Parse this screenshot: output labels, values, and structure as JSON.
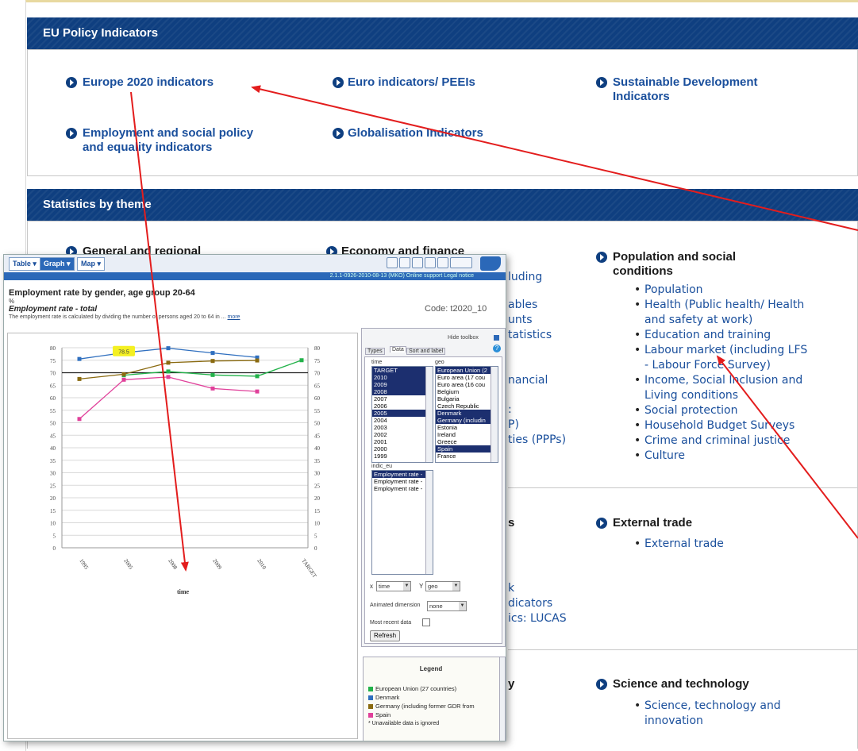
{
  "policy": {
    "header": "EU Policy Indicators",
    "links": [
      {
        "label": "Europe 2020 indicators"
      },
      {
        "label": "Euro indicators/ PEEIs"
      },
      {
        "label": "Sustainable Development\nIndicators"
      },
      {
        "label": "Employment and social policy\nand equality indicators"
      },
      {
        "label": "Globalisation Indicators"
      }
    ]
  },
  "themes": {
    "header": "Statistics by theme",
    "general": "General and regional",
    "economy": "Economy and finance",
    "population": {
      "title": "Population and social\nconditions",
      "items": [
        "Population",
        "Health (Public health/ Health\nand safety at work)",
        "Education and training",
        "Labour market (including LFS\n- Labour Force Survey)",
        "Income, Social Inclusion and\nLiving conditions",
        "Social protection",
        "Household Budget Surveys",
        "Crime and criminal justice",
        "Culture"
      ]
    },
    "external_trade": {
      "title": "External trade",
      "items": [
        "External trade"
      ]
    },
    "science": {
      "title": "Science and technology",
      "items": [
        "Science, technology and\ninnovation"
      ]
    },
    "fragments": [
      "luding",
      "ables",
      "unts",
      "tatistics",
      "nancial",
      ":",
      "P)",
      "ties (PPPs)",
      "s",
      "k",
      "dicators",
      "ics: LUCAS",
      "y"
    ]
  },
  "overlay": {
    "tabs": [
      "Table ▾",
      "Graph ▾",
      "Map ▾"
    ],
    "strip_text": "2.1.1-0926-2010-08-13 (MKO)   Online support   Legal notice",
    "title": "Employment rate by gender, age group 20-64",
    "unit": "%",
    "subtitle": "Employment rate - total",
    "description": "The employment rate is calculated by dividing the number of persons aged 20 to 64 in ...",
    "more": "more",
    "code": "Code: t2020_10",
    "hide_toolbox": "Hide toolbox",
    "panel_tabs": [
      "Types",
      "Data",
      "Sort and label"
    ],
    "time_label": "time",
    "geo_label": "geo",
    "time_options": [
      "TARGET",
      "2010",
      "2009",
      "2008",
      "2007",
      "2006",
      "2005",
      "2004",
      "2003",
      "2002",
      "2001",
      "2000",
      "1999"
    ],
    "time_selected": [
      "TARGET",
      "2010",
      "2009",
      "2008",
      "2005"
    ],
    "geo_options": [
      "European Union (2",
      "Euro area (17 cou",
      "Euro area (16 cou",
      "Belgium",
      "Bulgaria",
      "Czech Republic",
      "Denmark",
      "Germany (includin",
      "Estonia",
      "Ireland",
      "Greece",
      "Spain",
      "France"
    ],
    "geo_selected": [
      "European Union (2",
      "Denmark",
      "Germany (includin",
      "Spain"
    ],
    "indic_label": "indic_eu",
    "indic_options": [
      "Employment rate -",
      "Employment rate -",
      "Employment rate -"
    ],
    "x_label": "x",
    "x_value": "time",
    "y_label": "Y",
    "y_value": "geo",
    "animated_label": "Animated dimension",
    "animated_value": "none",
    "most_recent_label": "Most recent data",
    "refresh": "Refresh",
    "legend_title": "Legend",
    "legend": [
      {
        "name": "European Union (27 countries)",
        "color": "#22b24a"
      },
      {
        "name": "Denmark",
        "color": "#2f6fbf"
      },
      {
        "name": "Germany (including  former GDR from",
        "color": "#8a6a10"
      },
      {
        "name": "Spain",
        "color": "#e0409a"
      }
    ],
    "legend_note": "* Unavailable data is ignored",
    "x_axis_title": "time"
  },
  "chart_data": {
    "type": "line",
    "title": "Employment rate by gender, age group 20-64",
    "xlabel": "time",
    "ylabel": "",
    "ylim": [
      0,
      80
    ],
    "yticks": [
      0,
      5,
      10,
      15,
      20,
      25,
      30,
      35,
      40,
      45,
      50,
      55,
      60,
      65,
      70,
      75,
      80
    ],
    "categories": [
      "1995",
      "2005",
      "2008",
      "2009",
      "2010",
      "TARGET"
    ],
    "target_line": 70,
    "highlight_label": "78.5",
    "series": [
      {
        "name": "European Union (27 countries)",
        "color": "#22b24a",
        "values": [
          null,
          69,
          70.5,
          69.1,
          68.6,
          75
        ]
      },
      {
        "name": "Denmark",
        "color": "#2f6fbf",
        "values": [
          75.5,
          78,
          79.8,
          77.9,
          76.1,
          null
        ]
      },
      {
        "name": "Germany (including  former GDR from",
        "color": "#8a6a10",
        "values": [
          67.5,
          69.4,
          74,
          74.7,
          74.9,
          null
        ]
      },
      {
        "name": "Spain",
        "color": "#e0409a",
        "values": [
          51.5,
          67.2,
          68.3,
          63.7,
          62.5,
          null
        ]
      }
    ]
  },
  "colors": {
    "header_bar": "#0f3f80",
    "link": "#1a4f9c",
    "arrow": "#e31d1d"
  }
}
